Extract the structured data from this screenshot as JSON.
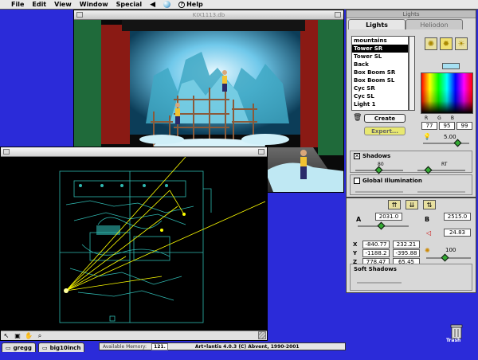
{
  "menubar": {
    "items": [
      "File",
      "Edit",
      "View",
      "Window",
      "Special",
      "Help"
    ]
  },
  "render_window": {
    "title": "KIX1113.db"
  },
  "lights_palette": {
    "title": "Lights",
    "tabs": [
      "Lights",
      "Heliodon"
    ],
    "lights": [
      {
        "label": "mountains",
        "selected": false
      },
      {
        "label": "Tower SR",
        "selected": true
      },
      {
        "label": "Tower SL",
        "selected": false
      },
      {
        "label": "Back",
        "selected": false
      },
      {
        "label": "Box Boom SR",
        "selected": false
      },
      {
        "label": "Box Boom SL",
        "selected": false
      },
      {
        "label": "Cyc SR",
        "selected": false
      },
      {
        "label": "Cyc SL",
        "selected": false
      },
      {
        "label": "Light 1",
        "selected": false
      }
    ],
    "create_label": "Create",
    "expert_label": "Expert...",
    "color": {
      "swatch": "#a6e0f2",
      "r_label": "R",
      "g_label": "G",
      "b_label": "B",
      "r": "77",
      "g": "95",
      "b": "99"
    },
    "intensity": "5.00",
    "shadows": {
      "label": "Shadows",
      "checked": true,
      "left_value": "80",
      "right_value": "RT"
    },
    "global_illumination": {
      "label": "Global Illumination",
      "checked": false
    }
  },
  "position_palette": {
    "a_label": "A",
    "b_label": "B",
    "a_value": "2031.0",
    "b_value": "2515.0",
    "angle_value": "24.83",
    "x_label": "X",
    "y_label": "Y",
    "z_label": "Z",
    "x_values": [
      "-840.77",
      "232.21"
    ],
    "y_values": [
      "-1188.2",
      "-395.88"
    ],
    "z_values": [
      "778.47",
      "65.45"
    ],
    "spot_value": "100",
    "soft_shadows_label": "Soft Shadows"
  },
  "desktop": {
    "trash_label": "Trash"
  },
  "taskbar": {
    "tabs": [
      "gregg",
      "big10inch"
    ],
    "available_memory_label": "Available Memory:",
    "available_memory_value": "121.",
    "app_info": "Art•lantis 4.0.3 (C) Abvent, 1990-2001"
  }
}
